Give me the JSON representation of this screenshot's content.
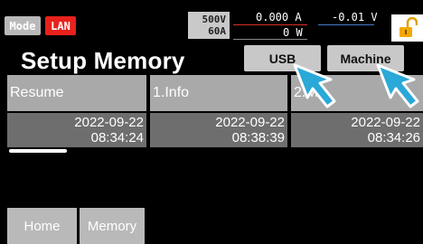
{
  "status": {
    "mode_label": "Mode",
    "lan_label": "LAN",
    "range_voltage": "500V",
    "range_current": "60A",
    "current": "0.000 A",
    "voltage": "-0.01 V",
    "power": "0 W"
  },
  "title": "Setup Memory",
  "buttons": {
    "usb": "USB",
    "machine": "Machine"
  },
  "entries": [
    {
      "name": "Resume",
      "date": "2022-09-22",
      "time": "08:34:24"
    },
    {
      "name": "1.Info",
      "date": "2022-09-22",
      "time": "08:38:39"
    },
    {
      "name": "2.M",
      "date": "2022-09-22",
      "time": "08:34:26"
    }
  ],
  "bottom_tabs": {
    "home": "Home",
    "memory": "Memory"
  },
  "colors": {
    "lan": "#e8211c",
    "lock": "#f2a900",
    "pointer": "#2aa8d8"
  },
  "icons": {
    "lock": "unlocked-padlock-icon",
    "pointer": "hand-pointer-icon"
  }
}
